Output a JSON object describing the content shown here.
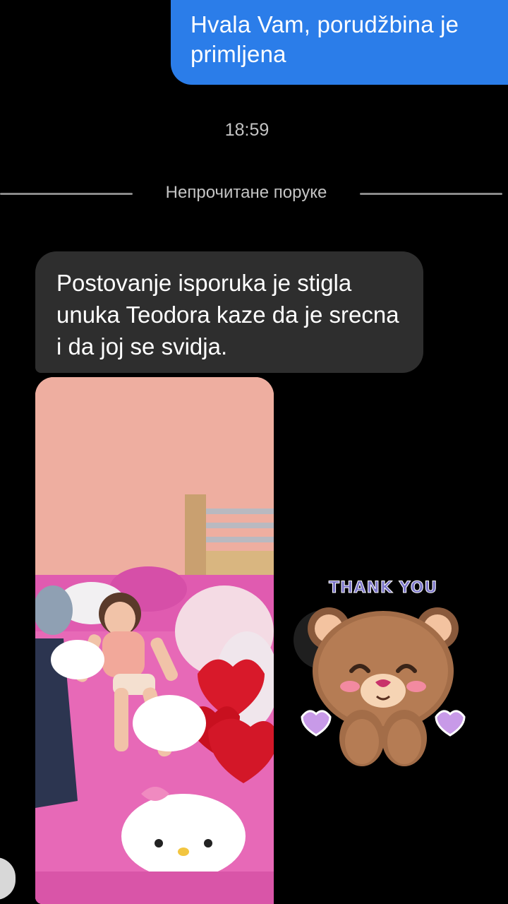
{
  "outgoing_message": {
    "text": "Hvala Vam, porudžbina je primljena"
  },
  "timestamp": "18:59",
  "unread_divider": "Непрочитане поруке",
  "incoming_message": {
    "text": "Postovanje isporuka je stigla unuka Teodora kaze da je srecna i da joj se svidja."
  },
  "photo_attachment": {
    "description_icon": "photo-attachment"
  },
  "sticker": {
    "caption": "THANK YOU",
    "icon": "teddy-bear-sticker"
  },
  "colors": {
    "outgoing_bubble": "#2b7de9",
    "incoming_bubble": "#2e2e2e",
    "background": "#000000",
    "secondary_text": "#c4c4c4"
  }
}
